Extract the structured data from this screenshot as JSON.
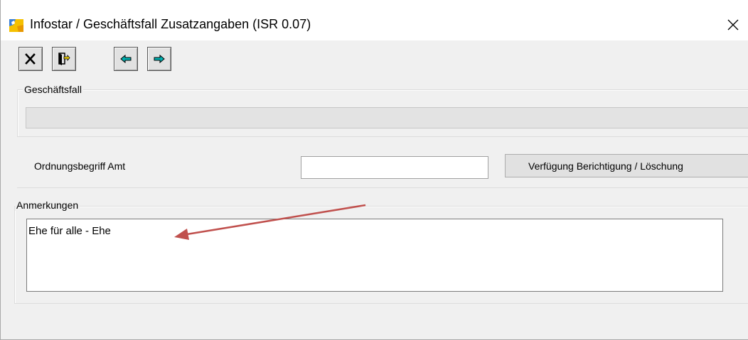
{
  "window": {
    "title": "Infostar / Geschäftsfall Zusatzangaben (ISR 0.07)"
  },
  "toolbar": {
    "buttons": [
      {
        "name": "close-x-icon"
      },
      {
        "name": "door-exit-icon"
      },
      {
        "name": "arrow-left-icon"
      },
      {
        "name": "arrow-right-icon"
      }
    ]
  },
  "geschaeftsfall": {
    "label": "Geschäftsfall",
    "value": ""
  },
  "ordnungsbegriff": {
    "label": "Ordnungsbegriff Amt",
    "value": ""
  },
  "verfuegung_button": {
    "label": "Verfügung Berichtigung / Löschung"
  },
  "anmerkungen": {
    "label": "Anmerkungen",
    "value": "Ehe für alle - Ehe"
  },
  "colors": {
    "annotation_arrow": "#c0504d",
    "toolbar_arrow": "#00b0b0"
  }
}
